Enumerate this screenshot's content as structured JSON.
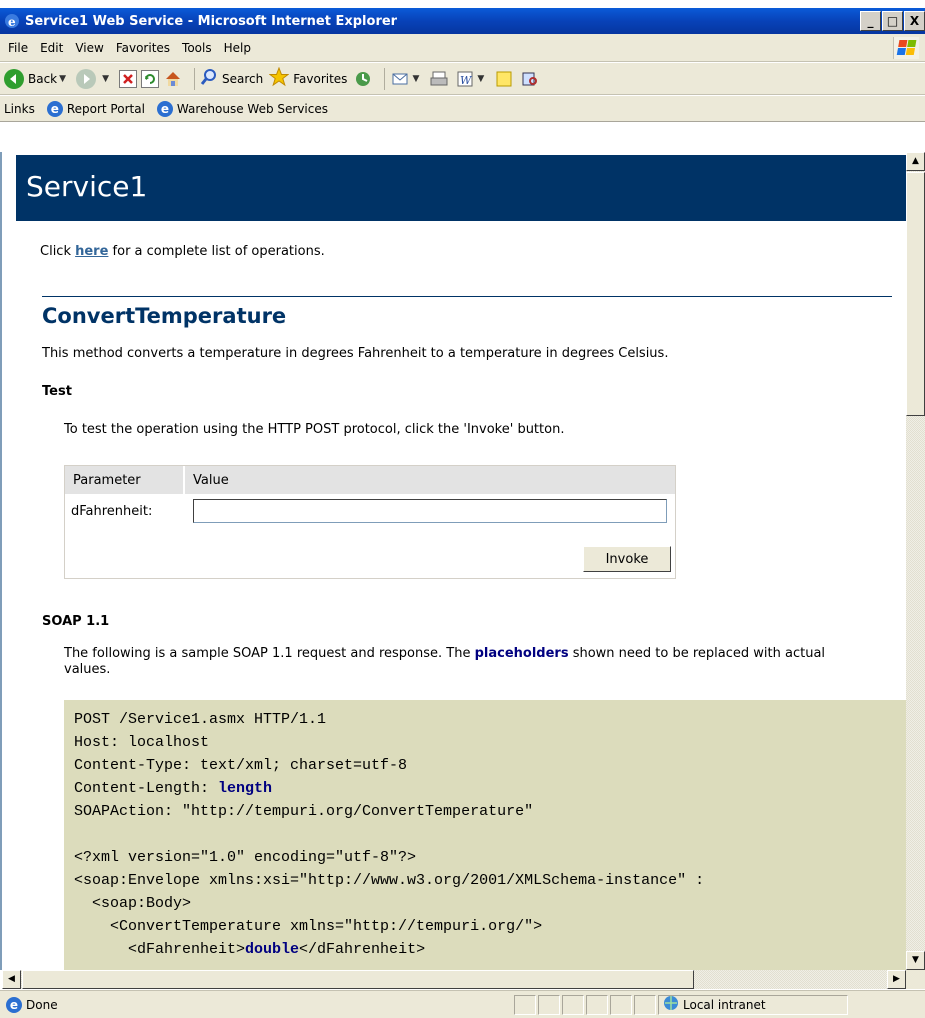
{
  "window": {
    "title": "Service1 Web Service - Microsoft Internet Explorer",
    "buttons": [
      "_",
      "□",
      "X"
    ]
  },
  "menu": [
    {
      "label": "File"
    },
    {
      "label": "Edit"
    },
    {
      "label": "View"
    },
    {
      "label": "Favorites"
    },
    {
      "label": "Tools"
    },
    {
      "label": "Help"
    }
  ],
  "toolbar": {
    "back": "Back",
    "search": "Search",
    "favorites": "Favorites"
  },
  "links": {
    "label": "Links",
    "items": [
      "Report Portal",
      "Warehouse Web Services"
    ]
  },
  "page": {
    "banner_title": "Service1",
    "intro_prefix": "Click ",
    "intro_link": "here",
    "intro_suffix": " for a complete list of operations.",
    "operation": {
      "title": "ConvertTemperature",
      "description": "This method converts a temperature in degrees Fahrenheit to a temperature in degrees Celsius."
    },
    "test": {
      "heading": "Test",
      "instruction": "To test the operation using the HTTP POST protocol, click the 'Invoke' button.",
      "col_parameter": "Parameter",
      "col_value": "Value",
      "param_label": "dFahrenheit:",
      "param_value": "",
      "invoke_label": "Invoke"
    },
    "soap": {
      "heading": "SOAP 1.1",
      "desc_prefix": "The following is a sample SOAP 1.1 request and response. The ",
      "desc_bold": "placeholders",
      "desc_suffix": " shown need to be replaced with actual values.",
      "code": {
        "l1": "POST /Service1.asmx HTTP/1.1",
        "l2": "Host: localhost",
        "l3": "Content-Type: text/xml; charset=utf-8",
        "l4a": "Content-Length: ",
        "l4b": "length",
        "l5": "SOAPAction: \"http://tempuri.org/ConvertTemperature\"",
        "l6": "",
        "l7": "<?xml version=\"1.0\" encoding=\"utf-8\"?>",
        "l8": "<soap:Envelope xmlns:xsi=\"http://www.w3.org/2001/XMLSchema-instance\" :",
        "l9": "  <soap:Body>",
        "l10": "    <ConvertTemperature xmlns=\"http://tempuri.org/\">",
        "l11a": "      <dFahrenheit>",
        "l11b": "double",
        "l11c": "</dFahrenheit>"
      }
    }
  },
  "status": {
    "text": "Done",
    "zone": "Local intranet"
  },
  "colors": {
    "banner": "#003366",
    "heading": "#003366",
    "link": "#336699",
    "code_bg": "#dcdcbc",
    "placeholder": "#000080"
  }
}
